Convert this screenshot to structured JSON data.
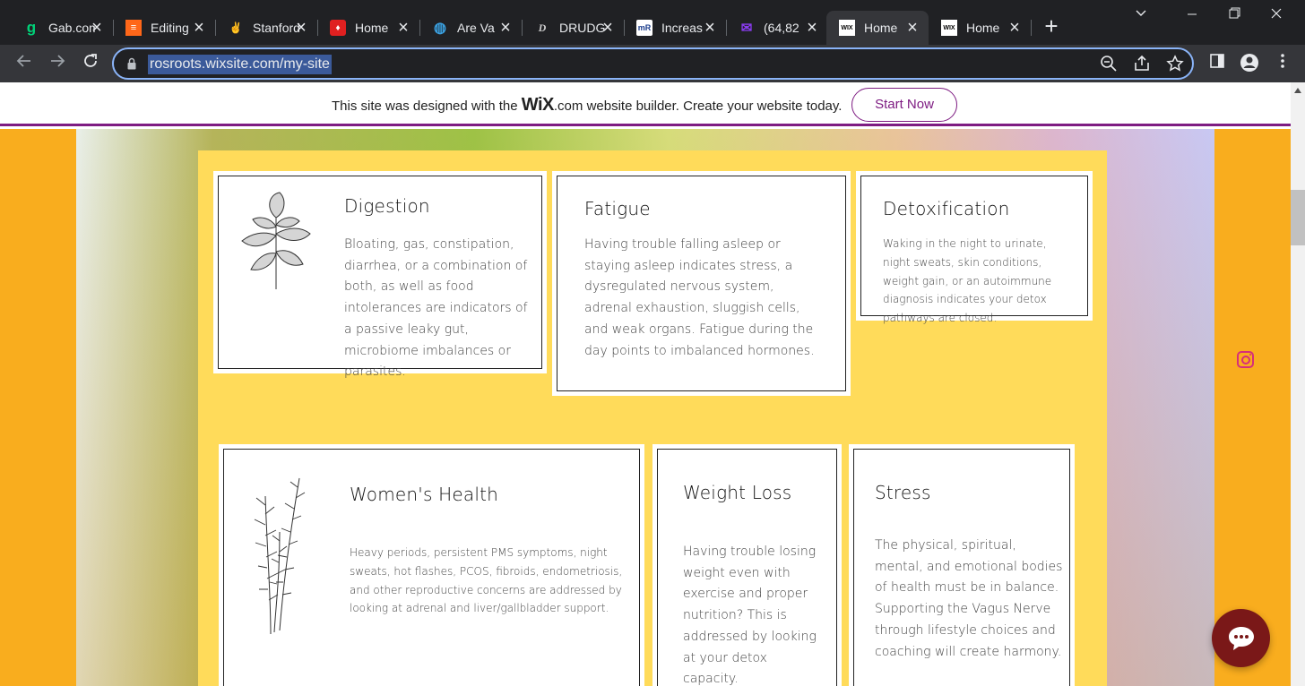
{
  "browser": {
    "tabs": [
      {
        "title": "Gab.com",
        "favicon": "gab-icon",
        "color": "#00d178",
        "glyph": "g"
      },
      {
        "title": "Editing",
        "favicon": "substack-icon",
        "color": "#ff6719",
        "glyph": "≡"
      },
      {
        "title": "Stanford",
        "favicon": "stanford-icon",
        "color": "#ffffff",
        "glyph": "✌"
      },
      {
        "title": "Home",
        "favicon": "home-icon",
        "color": "#e02020",
        "glyph": "♦"
      },
      {
        "title": "Are Va",
        "favicon": "globe-icon",
        "color": "#3aa0e0",
        "glyph": "◍"
      },
      {
        "title": "DRUDGE",
        "favicon": "drudge-icon",
        "color": "#ffffff",
        "glyph": "D"
      },
      {
        "title": "Increas",
        "favicon": "mr-icon",
        "color": "#1a3c8c",
        "glyph": "mR"
      },
      {
        "title": "(64,82",
        "favicon": "mail-icon",
        "color": "#6a1ed8",
        "glyph": "✉"
      },
      {
        "title": "Home",
        "favicon": "wix-icon",
        "color": "#ffffff",
        "glyph": "WIX"
      },
      {
        "title": "Home",
        "favicon": "wix-icon",
        "color": "#ffffff",
        "glyph": "WIX"
      }
    ],
    "url": "rosroots.wixsite.com/my-site"
  },
  "wix_banner": {
    "text_before": "This site was designed with the ",
    "brand": "WiX",
    "text_after": ".com website builder. Create your website today.",
    "button": "Start Now",
    "accent": "#7e1c82"
  },
  "cards": [
    {
      "title": "Digestion",
      "body": "Bloating, gas, constipation, diarrhea, or a combination of both, as well as food intolerances are indicators of a passive leaky gut, microbiome imbalances or parasites."
    },
    {
      "title": "Fatigue",
      "body": "Having trouble falling asleep or staying asleep indicates stress, a dysregulated nervous system, adrenal exhaustion, sluggish cells, and weak organs. Fatigue during the day points to imbalanced hormones."
    },
    {
      "title": "Detoxification",
      "body": "Waking in the night to urinate, night sweats, skin conditions, weight gain, or an autoimmune diagnosis indicates your detox pathways are closed."
    },
    {
      "title": "Women's Health",
      "body": "Heavy periods, persistent PMS symptoms, night sweats, hot flashes, PCOS, fibroids, endometriosis, and other reproductive concerns are addressed by looking at adrenal and liver/gallbladder support."
    },
    {
      "title": "Weight Loss",
      "body": "Having trouble losing weight even with exercise and proper nutrition? This is addressed by looking at your detox capacity."
    },
    {
      "title": "Stress",
      "body": "The physical, spiritual, mental, and emotional bodies of health must be in balance.  Supporting the Vagus Nerve through lifestyle choices and coaching will create harmony."
    }
  ],
  "colors": {
    "page_bg": "#f9ad1e",
    "panel_bg": "#ffdb5a",
    "chat_button": "#7a1818"
  }
}
